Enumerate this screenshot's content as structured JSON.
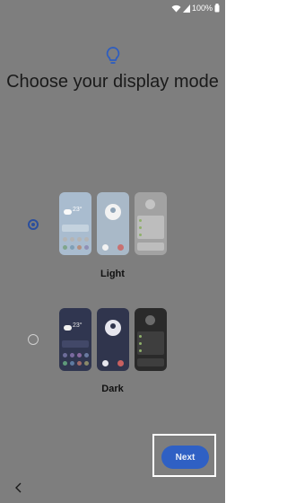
{
  "status": {
    "battery_text": "100%",
    "icons": [
      "wifi-icon",
      "signal-icon",
      "battery-icon"
    ]
  },
  "header": {
    "icon": "lightbulb-icon",
    "title": "Choose your display mode"
  },
  "modes": [
    {
      "label": "Light",
      "selected": true
    },
    {
      "label": "Dark",
      "selected": false
    }
  ],
  "preview": {
    "clock": "23°"
  },
  "footer": {
    "next_label": "Next",
    "back_icon": "chevron-left-icon"
  },
  "colors": {
    "background": "#7e7e7e",
    "accent": "#2f60c4",
    "radio_selected": "#2b4f9e"
  }
}
